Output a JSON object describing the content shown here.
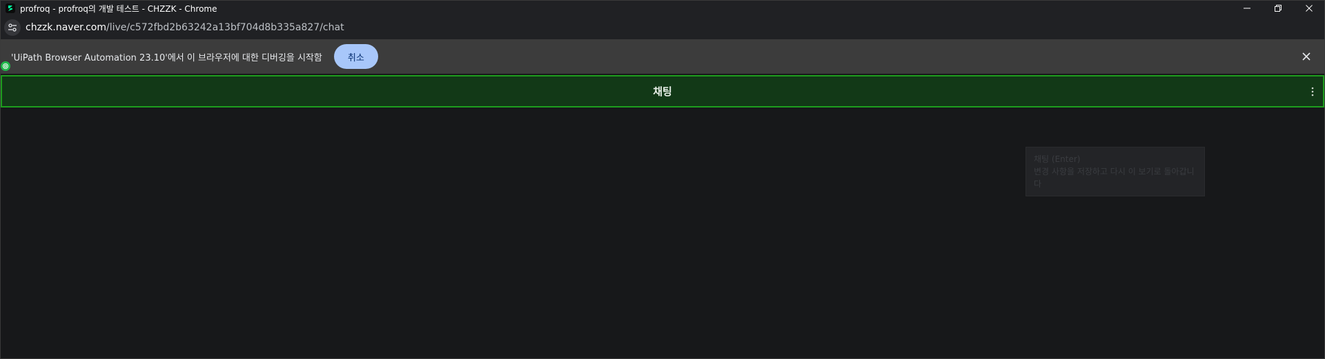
{
  "window": {
    "title": "profroq - profroq의 개발 테스트 - CHZZK - Chrome",
    "app_icon": "chzzk-logo-icon",
    "controls": [
      "minimize-icon",
      "restore-icon",
      "close-icon"
    ]
  },
  "address": {
    "host": "chzzk.naver.com",
    "path": "/live/c572fbd2b63242a13bf704d8b335a827/chat"
  },
  "infobar": {
    "message": "'UiPath Browser Automation 23.10'에서 이 브라우저에 대한 디버깅을 시작함",
    "cancel_label": "취소"
  },
  "chat": {
    "header_title": "채팅"
  },
  "tooltip": {
    "line1": "채팅 (Enter)",
    "line2": "변경 사항을 저장하고 다시 이 보기로 돌아갑니",
    "line3": "다"
  },
  "colors": {
    "accent_green": "#1d9e1d",
    "header_bg": "#123917",
    "cancel_button": "#a8c7fa",
    "page_bg": "#17181a"
  }
}
